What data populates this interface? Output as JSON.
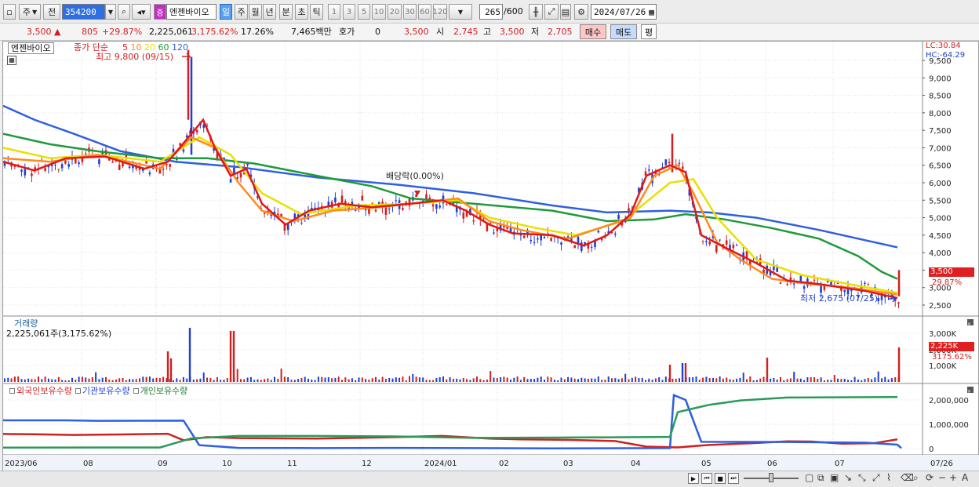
{
  "toolbar": {
    "mode_primary": "주",
    "mode_prev": "전",
    "code": "354200",
    "stock_icon": "증",
    "stock_name": "엔젠바이오",
    "periods": [
      "일",
      "주",
      "월",
      "년",
      "분",
      "초",
      "틱"
    ],
    "numbers": [
      "1",
      "3",
      "5",
      "10",
      "20",
      "30",
      "60",
      "120"
    ],
    "count": "265",
    "count_total": "/600",
    "date": "2024/07/26"
  },
  "quote": {
    "price": "3,500",
    "change": "805",
    "change_pct": "+29.87%",
    "volume": "2,225,061",
    "volume_pct": "3,175.62%",
    "turnover": "17.26%",
    "amount": "7,465백만",
    "hoga_label": "호가",
    "hoga_value": "0",
    "hoga_price": "3,500",
    "open_label": "시",
    "open": "2,745",
    "high_label": "고",
    "high": "3,500",
    "low_label": "저",
    "low": "2,705",
    "buy_label": "매수",
    "sell_label": "매도",
    "avg_label": "평"
  },
  "main_chart": {
    "name_tag": "엔젠바이오",
    "legend_prefix": "종가 단순",
    "ma": [
      {
        "p": "5",
        "color": "#e01818"
      },
      {
        "p": "10",
        "color": "#ff8a1e"
      },
      {
        "p": "20",
        "color": "#e8e000"
      },
      {
        "p": "60",
        "color": "#1f9a3a"
      },
      {
        "p": "120",
        "color": "#2f5fe0"
      }
    ],
    "high_note": "최고 9,800 (09/15)",
    "low_note": "최저 2,675 (07/25)",
    "dividend_note": "배당락(0.00%)",
    "lc": "LC:30.84",
    "hc": "HC:-64.29",
    "price_ticks": [
      "9,500",
      "9,000",
      "8,500",
      "8,000",
      "7,500",
      "7,000",
      "6,500",
      "6,000",
      "5,500",
      "5,000",
      "4,500",
      "4,000",
      "3,500",
      "3,000",
      "2,500"
    ],
    "last_price": "3,500",
    "last_pct": "29.87%",
    "colors": {
      "up": "#d21f1f",
      "down": "#1f3fd2",
      "ma5": "#e01818",
      "ma10": "#ff8a1e",
      "ma20": "#e8e000",
      "ma60": "#1f9a3a",
      "ma120": "#2f5fe0"
    }
  },
  "volume_chart": {
    "title": "거래량",
    "value": "2,225,061주(3,175.62%)",
    "ticks": [
      "3,000K",
      "2,000K",
      "1,000K"
    ],
    "last": "2,225K",
    "last_pct": "3175.62%"
  },
  "holding_chart": {
    "series": [
      "외국인보유수량",
      "기관보유수량",
      "개인보유수량"
    ],
    "ticks": [
      "2,000,000",
      "1,000,000",
      "0"
    ]
  },
  "x_axis": [
    "2023/06",
    "08",
    "09",
    "10",
    "11",
    "12",
    "2024/01",
    "02",
    "03",
    "04",
    "05",
    "06",
    "07",
    "07/26"
  ],
  "chart_data": {
    "type": "candlestick",
    "price_range": [
      2500,
      9800
    ],
    "ma120": [
      [
        0,
        8200
      ],
      [
        40,
        7800
      ],
      [
        90,
        7400
      ],
      [
        150,
        6900
      ],
      [
        220,
        6600
      ],
      [
        300,
        6450
      ],
      [
        400,
        6150
      ],
      [
        500,
        5950
      ],
      [
        600,
        5700
      ],
      [
        700,
        5350
      ],
      [
        770,
        5150
      ],
      [
        850,
        5200
      ],
      [
        900,
        5150
      ],
      [
        960,
        5000
      ],
      [
        1040,
        4650
      ],
      [
        1100,
        4350
      ],
      [
        1140,
        4150
      ]
    ],
    "ma60": [
      [
        0,
        7400
      ],
      [
        60,
        7100
      ],
      [
        120,
        6900
      ],
      [
        200,
        6700
      ],
      [
        260,
        6700
      ],
      [
        320,
        6550
      ],
      [
        400,
        6200
      ],
      [
        470,
        5900
      ],
      [
        520,
        5550
      ],
      [
        600,
        5400
      ],
      [
        700,
        5200
      ],
      [
        770,
        4900
      ],
      [
        830,
        4950
      ],
      [
        870,
        5100
      ],
      [
        920,
        4950
      ],
      [
        980,
        4700
      ],
      [
        1040,
        4400
      ],
      [
        1090,
        3900
      ],
      [
        1120,
        3450
      ],
      [
        1140,
        3250
      ]
    ],
    "ma20": [
      [
        0,
        7000
      ],
      [
        60,
        6700
      ],
      [
        120,
        6800
      ],
      [
        200,
        6600
      ],
      [
        250,
        7300
      ],
      [
        290,
        6800
      ],
      [
        330,
        5700
      ],
      [
        380,
        5100
      ],
      [
        450,
        5350
      ],
      [
        520,
        5400
      ],
      [
        580,
        5500
      ],
      [
        620,
        5000
      ],
      [
        680,
        4700
      ],
      [
        730,
        4500
      ],
      [
        790,
        4900
      ],
      [
        850,
        6000
      ],
      [
        880,
        6100
      ],
      [
        910,
        5000
      ],
      [
        960,
        3800
      ],
      [
        1020,
        3350
      ],
      [
        1090,
        3050
      ],
      [
        1140,
        2850
      ]
    ],
    "ma10": [
      [
        0,
        6700
      ],
      [
        60,
        6600
      ],
      [
        120,
        6800
      ],
      [
        200,
        6400
      ],
      [
        240,
        7300
      ],
      [
        270,
        7000
      ],
      [
        300,
        6000
      ],
      [
        330,
        5200
      ],
      [
        370,
        4900
      ],
      [
        420,
        5200
      ],
      [
        480,
        5300
      ],
      [
        540,
        5450
      ],
      [
        580,
        5550
      ],
      [
        620,
        4900
      ],
      [
        660,
        4650
      ],
      [
        720,
        4400
      ],
      [
        760,
        4700
      ],
      [
        800,
        5000
      ],
      [
        830,
        6200
      ],
      [
        860,
        6500
      ],
      [
        880,
        5700
      ],
      [
        910,
        4300
      ],
      [
        940,
        3800
      ],
      [
        980,
        3250
      ],
      [
        1030,
        3100
      ],
      [
        1080,
        3000
      ],
      [
        1140,
        2800
      ]
    ],
    "ma5": [
      [
        0,
        6600
      ],
      [
        40,
        6350
      ],
      [
        80,
        6700
      ],
      [
        130,
        6750
      ],
      [
        180,
        6400
      ],
      [
        210,
        6600
      ],
      [
        240,
        7400
      ],
      [
        255,
        7800
      ],
      [
        270,
        7000
      ],
      [
        290,
        6200
      ],
      [
        310,
        6400
      ],
      [
        330,
        5400
      ],
      [
        360,
        4800
      ],
      [
        390,
        5200
      ],
      [
        430,
        5400
      ],
      [
        470,
        5300
      ],
      [
        520,
        5400
      ],
      [
        560,
        5500
      ],
      [
        590,
        5200
      ],
      [
        620,
        4800
      ],
      [
        650,
        4550
      ],
      [
        700,
        4500
      ],
      [
        740,
        4200
      ],
      [
        770,
        4500
      ],
      [
        800,
        5100
      ],
      [
        820,
        6200
      ],
      [
        850,
        6500
      ],
      [
        870,
        6300
      ],
      [
        890,
        4500
      ],
      [
        920,
        4150
      ],
      [
        960,
        3700
      ],
      [
        1000,
        3200
      ],
      [
        1040,
        3100
      ],
      [
        1100,
        2900
      ],
      [
        1130,
        2750
      ],
      [
        1140,
        2700
      ]
    ],
    "foreign_holding": [
      [
        0,
        600
      ],
      [
        40,
        590
      ],
      [
        90,
        560
      ],
      [
        150,
        580
      ],
      [
        210,
        610
      ],
      [
        230,
        340
      ],
      [
        260,
        470
      ],
      [
        300,
        430
      ],
      [
        400,
        410
      ],
      [
        450,
        440
      ],
      [
        500,
        470
      ],
      [
        560,
        520
      ],
      [
        620,
        410
      ],
      [
        660,
        380
      ],
      [
        720,
        360
      ],
      [
        780,
        310
      ],
      [
        820,
        80
      ],
      [
        860,
        50
      ],
      [
        900,
        150
      ],
      [
        960,
        230
      ],
      [
        1000,
        300
      ],
      [
        1030,
        290
      ],
      [
        1070,
        200
      ],
      [
        1110,
        220
      ],
      [
        1140,
        380
      ]
    ],
    "inst_holding": [
      [
        0,
        1160
      ],
      [
        80,
        1160
      ],
      [
        120,
        1140
      ],
      [
        230,
        1150
      ],
      [
        250,
        140
      ],
      [
        300,
        30
      ],
      [
        400,
        20
      ],
      [
        500,
        30
      ],
      [
        600,
        20
      ],
      [
        700,
        10
      ],
      [
        850,
        20
      ],
      [
        855,
        2200
      ],
      [
        870,
        2000
      ],
      [
        890,
        280
      ],
      [
        1000,
        270
      ],
      [
        1100,
        240
      ],
      [
        1140,
        160
      ],
      [
        1145,
        20
      ]
    ],
    "indiv_holding": [
      [
        0,
        40
      ],
      [
        200,
        45
      ],
      [
        240,
        420
      ],
      [
        300,
        520
      ],
      [
        400,
        520
      ],
      [
        500,
        500
      ],
      [
        600,
        440
      ],
      [
        700,
        450
      ],
      [
        850,
        480
      ],
      [
        860,
        1500
      ],
      [
        900,
        1800
      ],
      [
        940,
        1980
      ],
      [
        1000,
        2100
      ],
      [
        1140,
        2120
      ]
    ]
  }
}
